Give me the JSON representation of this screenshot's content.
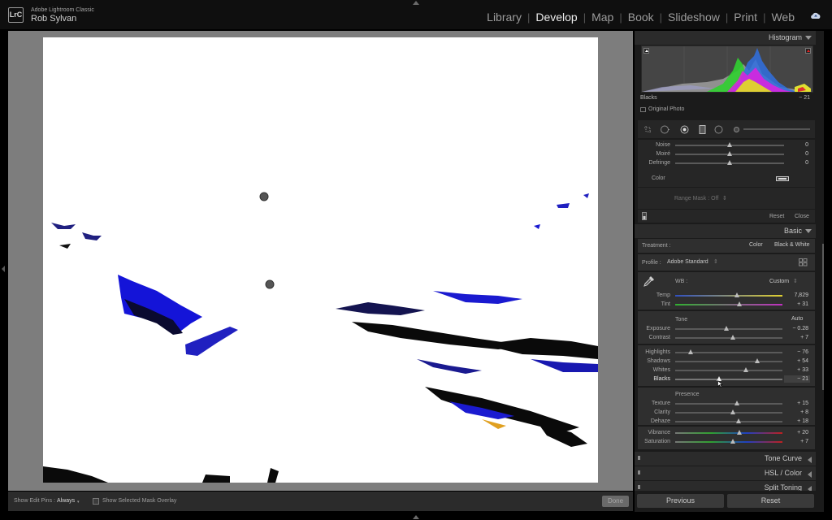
{
  "app": {
    "logo": "LrC",
    "name": "Adobe Lightroom Classic",
    "user": "Rob Sylvan"
  },
  "modules": [
    {
      "label": "Library",
      "active": false
    },
    {
      "label": "Develop",
      "active": true
    },
    {
      "label": "Map",
      "active": false
    },
    {
      "label": "Book",
      "active": false
    },
    {
      "label": "Slideshow",
      "active": false
    },
    {
      "label": "Print",
      "active": false
    },
    {
      "label": "Web",
      "active": false
    }
  ],
  "toolbar": {
    "show_edit_pins_label": "Show Edit Pins :",
    "show_edit_pins_value": "Always",
    "show_overlay_label": "Show Selected Mask Overlay",
    "done_label": "Done"
  },
  "histogram": {
    "title": "Histogram",
    "info_label": "Blacks",
    "info_value": "− 21",
    "original_photo_label": "Original Photo"
  },
  "detail": {
    "sliders": [
      {
        "label": "Noise",
        "value": "0",
        "position": 0.5
      },
      {
        "label": "Moiré",
        "value": "0",
        "position": 0.5
      },
      {
        "label": "Defringe",
        "value": "0",
        "position": 0.5
      }
    ],
    "color_label": "Color",
    "range_mask_label": "Range Mask : Off",
    "reset_label": "Reset",
    "close_label": "Close"
  },
  "basic": {
    "title": "Basic",
    "treatment_label": "Treatment :",
    "treatment_color": "Color",
    "treatment_bw": "Black & White",
    "profile_label": "Profile :",
    "profile_value": "Adobe Standard",
    "wb_label": "WB :",
    "wb_value": "Custom",
    "wb_sliders": [
      {
        "label": "Temp",
        "value": "7,829",
        "position": 0.55
      },
      {
        "label": "Tint",
        "value": "+ 31",
        "position": 0.57
      }
    ],
    "tone_label": "Tone",
    "auto_label": "Auto",
    "tone_sliders": [
      {
        "label": "Exposure",
        "value": "− 0.28",
        "position": 0.47
      },
      {
        "label": "Contrast",
        "value": "+ 7",
        "position": 0.53
      }
    ],
    "tone_sliders2": [
      {
        "label": "Highlights",
        "value": "− 76",
        "position": 0.14
      },
      {
        "label": "Shadows",
        "value": "+ 54",
        "position": 0.76
      },
      {
        "label": "Whites",
        "value": "+ 33",
        "position": 0.66
      },
      {
        "label": "Blacks",
        "value": "− 21",
        "position": 0.41
      }
    ],
    "presence_label": "Presence",
    "presence_sliders": [
      {
        "label": "Texture",
        "value": "+ 15",
        "position": 0.57
      },
      {
        "label": "Clarity",
        "value": "+ 8",
        "position": 0.54
      },
      {
        "label": "Dehaze",
        "value": "+ 18",
        "position": 0.58
      }
    ],
    "presence_sliders2": [
      {
        "label": "Vibrance",
        "value": "+ 20",
        "position": 0.6
      },
      {
        "label": "Saturation",
        "value": "+ 7",
        "position": 0.54
      }
    ]
  },
  "collapsed_sections": [
    {
      "label": "Tone Curve"
    },
    {
      "label": "HSL / Color"
    },
    {
      "label": "Split Toning"
    }
  ],
  "footer": {
    "previous_label": "Previous",
    "reset_label": "Reset"
  },
  "colors": {
    "accent": "#ececec",
    "panel": "#2f2f2f",
    "mask_blue": "#1010e0"
  }
}
